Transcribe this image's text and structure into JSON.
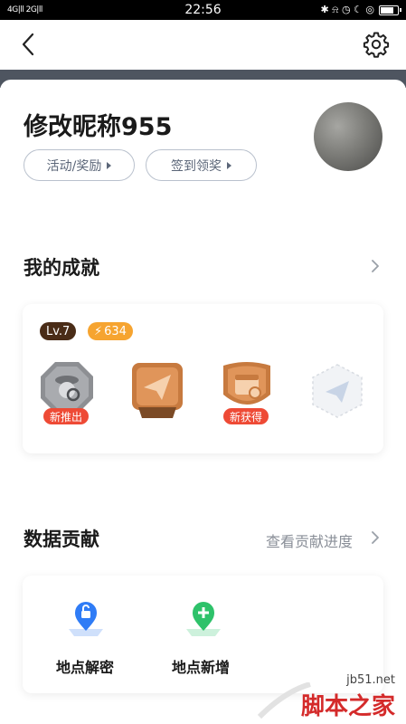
{
  "status_bar": {
    "signal_left": "4G|ll 2G|ll",
    "time": "22:56",
    "right_icons": "✱ ⍾ ◷ ☾ ◎"
  },
  "header": {
    "back_icon": "chevron-left-icon",
    "settings_icon": "gear-icon"
  },
  "profile": {
    "nickname": "修改昵称955",
    "buttons": [
      {
        "label": "活动/奖励"
      },
      {
        "label": "签到领奖"
      }
    ]
  },
  "achievements": {
    "title": "我的成就",
    "level": "Lv.7",
    "points": "634",
    "badges": [
      {
        "tag": "新推出",
        "icon": "detective-badge-icon",
        "color": "#8d8f93"
      },
      {
        "tag": "",
        "icon": "paper-plane-badge-icon",
        "color": "#c77a3f"
      },
      {
        "tag": "新获得",
        "icon": "calendar-badge-icon",
        "color": "#c77a3f"
      },
      {
        "tag": "",
        "icon": "paper-plane-locked-badge-icon",
        "color": "#e6e9ee"
      }
    ]
  },
  "data_contribution": {
    "title": "数据贡献",
    "link": "查看贡献进度",
    "items": [
      {
        "label": "地点解密",
        "icon": "unlock-pin-icon",
        "color": "#2f7cf6"
      },
      {
        "label": "地点新增",
        "icon": "add-pin-icon",
        "color": "#2ec26a"
      }
    ]
  },
  "watermark": {
    "url": "jb51.net",
    "text": "脚本之家"
  }
}
